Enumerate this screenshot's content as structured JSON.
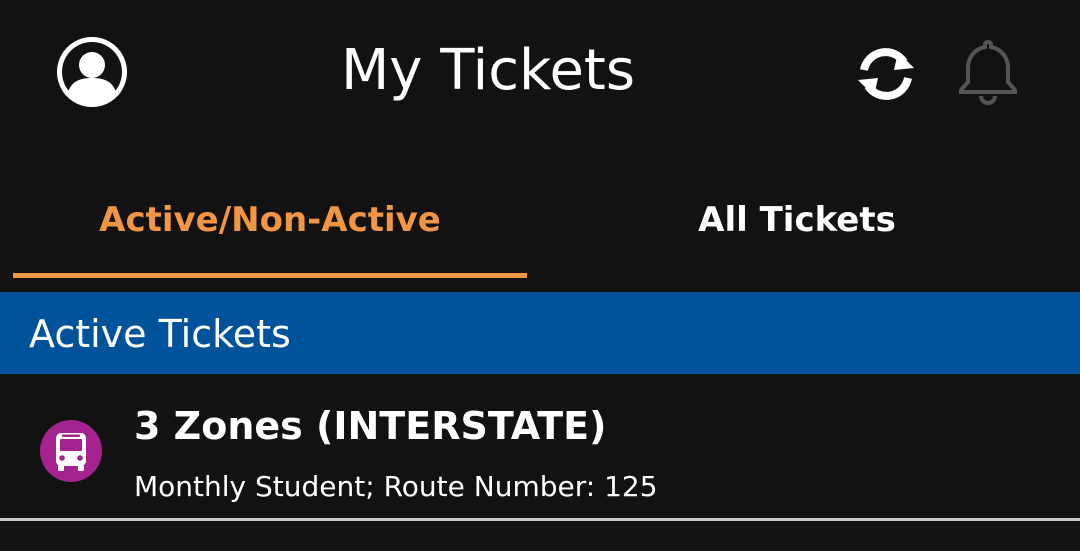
{
  "header": {
    "title": "My Tickets",
    "profile_icon": "account-circle-icon",
    "refresh_icon": "refresh-icon",
    "bell_icon": "bell-icon"
  },
  "tabs": [
    {
      "label": "Active/Non-Active",
      "selected": true
    },
    {
      "label": "All Tickets",
      "selected": false
    }
  ],
  "section": {
    "title": "Active Tickets"
  },
  "tickets": [
    {
      "name": "3 Zones (INTERSTATE)",
      "type": "Monthly Student;",
      "route": "Route Number: 125",
      "icon": "bus-icon"
    }
  ],
  "colors": {
    "background": "#121212",
    "accent": "#f29544",
    "section_header": "#00529b",
    "bus_badge": "#a5228f"
  }
}
